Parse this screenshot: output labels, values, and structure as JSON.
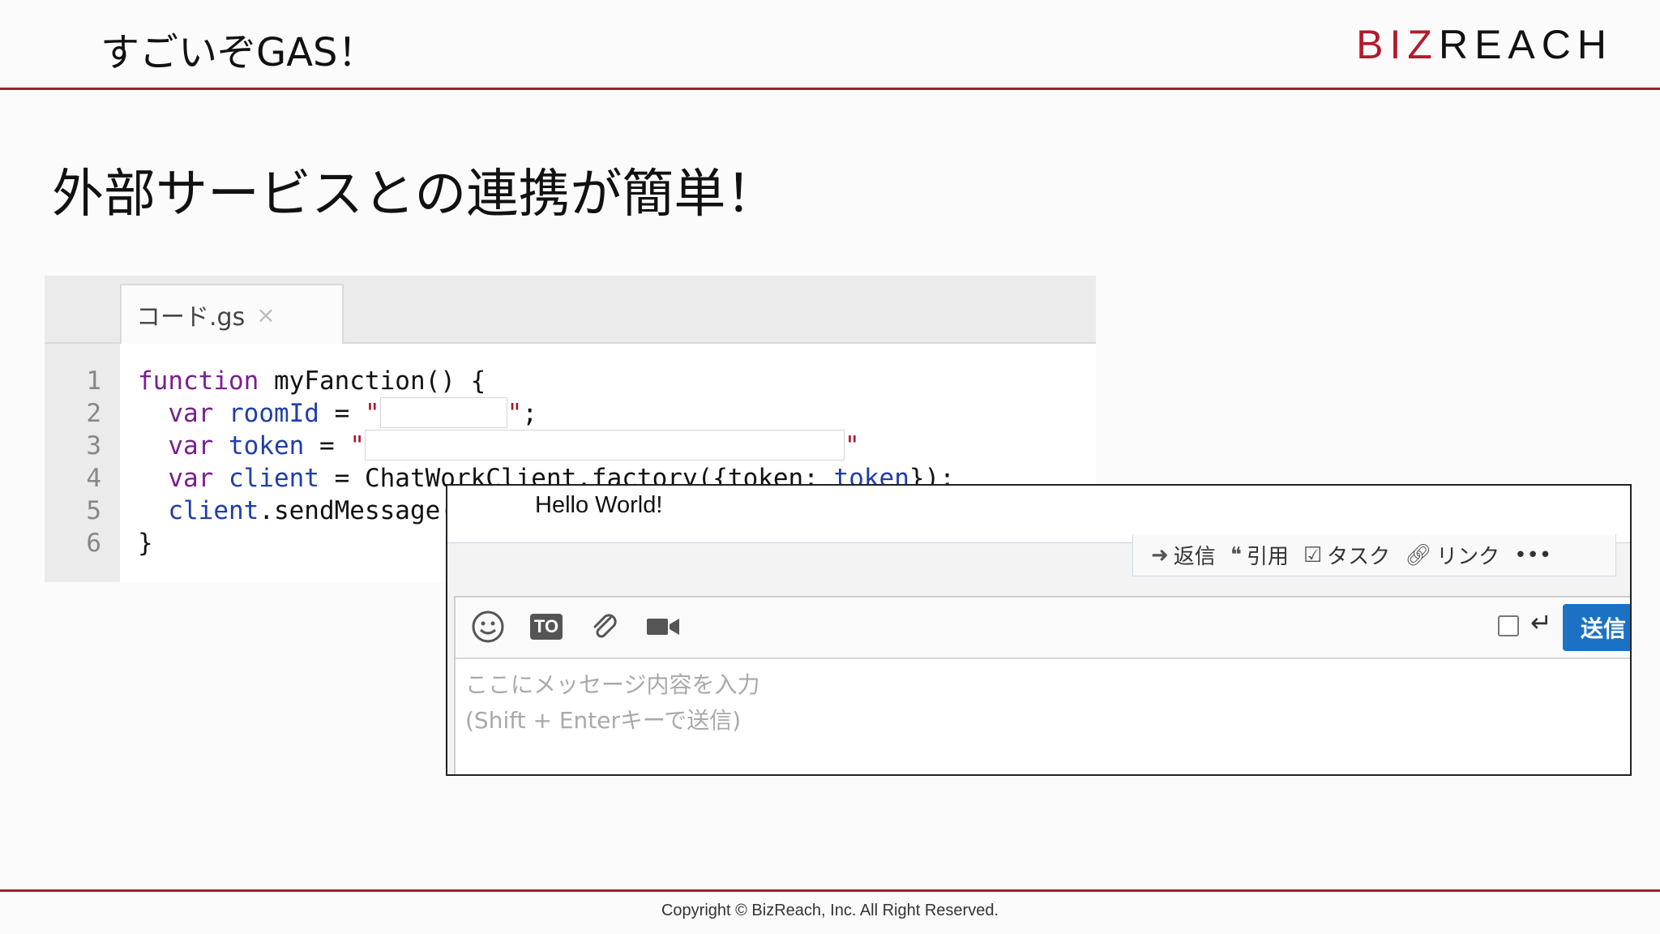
{
  "slide": {
    "title": "すごいぞGAS！",
    "subheading": "外部サービスとの連携が簡単！",
    "footer": "Copyright © BizReach, Inc. All Right Reserved."
  },
  "logo": {
    "part1": "BIZ",
    "part2": "REACH",
    "brand_color": "#b4192c"
  },
  "editor": {
    "tab_label": "コード.gs",
    "tab_close": "×",
    "line_numbers": [
      "1",
      "2",
      "3",
      "4",
      "5",
      "6"
    ],
    "lines": {
      "l1_kw": "function",
      "l1_rest": " myFanction() {",
      "l2_kw": "  var",
      "l2_var": " roomId",
      "l2_eq": " = ",
      "l2_q1": "\"",
      "l2_q2": "\"",
      "l2_end": ";",
      "l3_kw": "  var",
      "l3_var": " token",
      "l3_eq": " = ",
      "l3_q1": "\"",
      "l3_q2": "\"",
      "l4_kw": "  var",
      "l4_var": " client",
      "l4_rest": " = ChatWorkClient.factory({token: ",
      "l4_var2": "token",
      "l4_end": "});",
      "l5_var": "  client",
      "l5_rest": ".sendMessage(",
      "l6": "}"
    }
  },
  "chat": {
    "message": "Hello World!",
    "actions": [
      {
        "icon": "reply-arrow-icon",
        "label": "返信"
      },
      {
        "icon": "quote-icon",
        "label": "引用"
      },
      {
        "icon": "task-check-icon",
        "label": "タスク"
      },
      {
        "icon": "link-icon",
        "label": "リンク"
      }
    ],
    "more": "•••",
    "toolbar_to_label": "TO",
    "send_label": "送信",
    "placeholder_line1": "ここにメッセージ内容を入力",
    "placeholder_line2": "(Shift + Enterキーで送信)",
    "send_color": "#1b72c4"
  }
}
